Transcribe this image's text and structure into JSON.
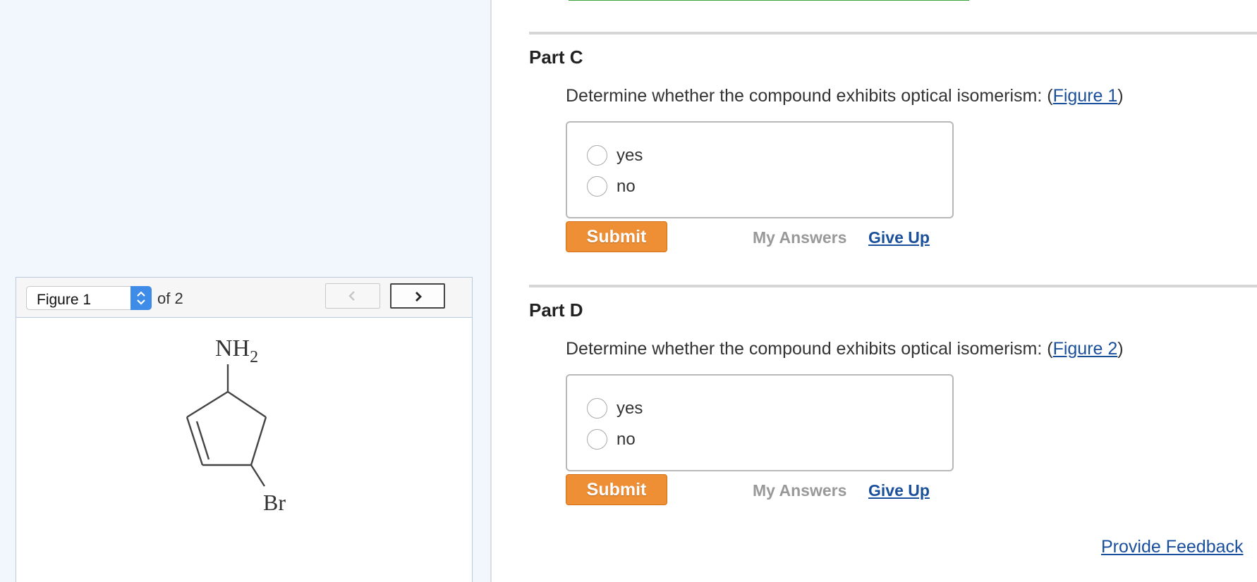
{
  "figure_viewer": {
    "selected_figure": "Figure 1",
    "of_label": "of 2",
    "prev_icon": "chevron-left-icon",
    "next_icon": "chevron-right-icon",
    "molecule": {
      "top_group": "NH",
      "top_group_subscript": "2",
      "bottom_group": "Br"
    }
  },
  "parts": [
    {
      "title": "Part C",
      "question_text": "Determine whether the compound exhibits optical isomerism: (",
      "figure_link": "Figure 1",
      "question_close": ")",
      "options": [
        "yes",
        "no"
      ],
      "submit_label": "Submit",
      "my_answers_label": "My Answers",
      "give_up_label": "Give Up"
    },
    {
      "title": "Part D",
      "question_text": "Determine whether the compound exhibits optical isomerism: (",
      "figure_link": "Figure 2",
      "question_close": ")",
      "options": [
        "yes",
        "no"
      ],
      "submit_label": "Submit",
      "my_answers_label": "My Answers",
      "give_up_label": "Give Up"
    }
  ],
  "feedback_link": "Provide Feedback",
  "colors": {
    "submit": "#ef8f35",
    "link": "#1a4f9c",
    "sidebar_bg": "#f2f6fd",
    "progress_green": "#3ba33b"
  }
}
